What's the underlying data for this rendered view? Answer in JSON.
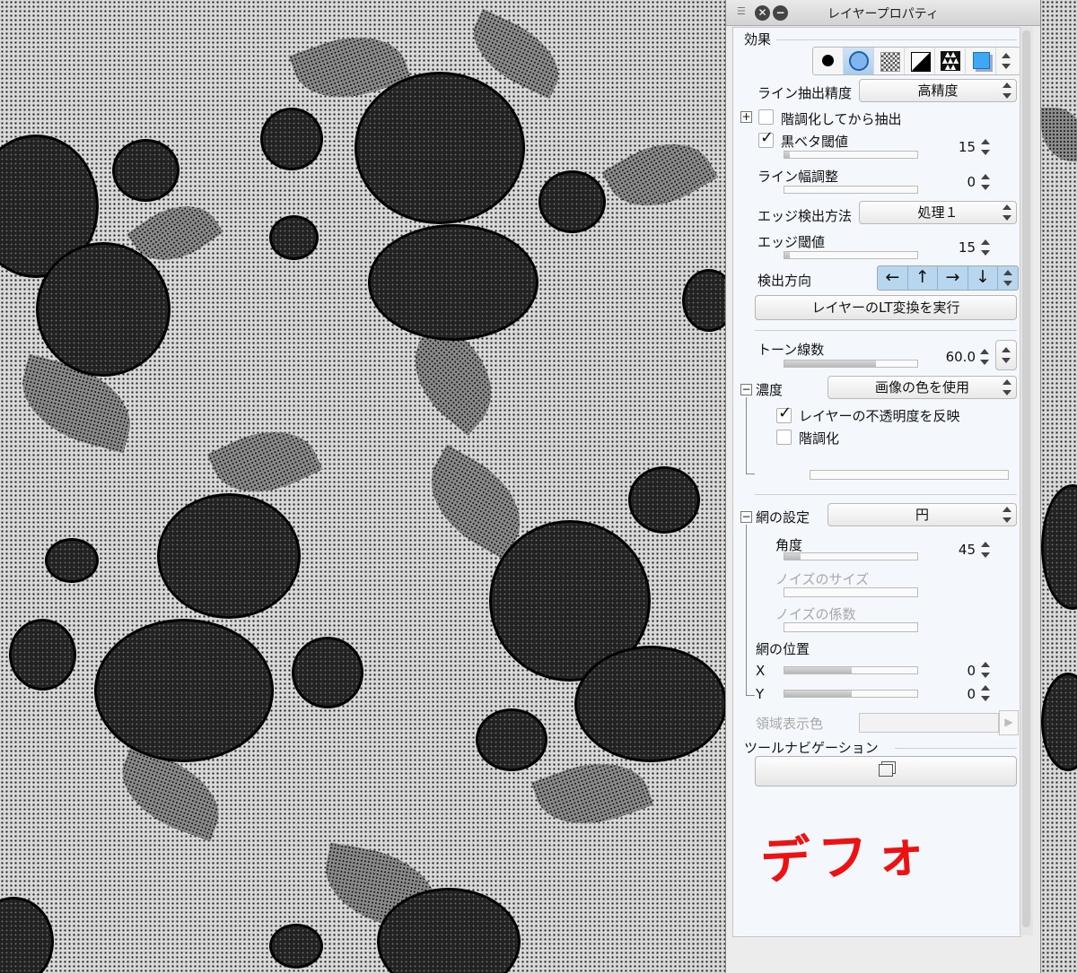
{
  "window": {
    "title": "レイヤープロパティ"
  },
  "effect": {
    "section_label": "効果",
    "icons": [
      "black-dot-icon",
      "circle-tone-icon",
      "checker-tone-icon",
      "diagonal-icon",
      "triangle-pattern-icon",
      "color-square-icon"
    ]
  },
  "line_extraction": {
    "precision_label": "ライン抽出精度",
    "precision_value": "高精度",
    "gradation_extract_label": "階調化してから抽出",
    "black_threshold_label": "黒ベタ閾値",
    "black_threshold_checked": true,
    "black_threshold_value": "15",
    "line_width_label": "ライン幅調整",
    "line_width_value": "0",
    "edge_method_label": "エッジ検出方法",
    "edge_method_value": "処理１",
    "edge_threshold_label": "エッジ閾値",
    "edge_threshold_value": "15",
    "direction_label": "検出方向",
    "direction_arrows": [
      "←",
      "↑",
      "→",
      "↓"
    ],
    "convert_button": "レイヤーのLT変換を実行"
  },
  "tone": {
    "frequency_label": "トーン線数",
    "frequency_value": "60.0",
    "density_label": "濃度",
    "density_value": "画像の色を使用",
    "reflect_opacity_label": "レイヤーの不透明度を反映",
    "reflect_opacity_checked": true,
    "gradation_label": "階調化",
    "gradation_checked": false,
    "screen_label": "網の設定",
    "screen_value": "円",
    "angle_label": "角度",
    "angle_value": "45",
    "noise_size_label": "ノイズのサイズ",
    "noise_factor_label": "ノイズの係数",
    "position_label": "網の位置",
    "x_label": "X",
    "x_value": "0",
    "y_label": "Y",
    "y_value": "0",
    "area_color_label": "領域表示色"
  },
  "tool_nav": {
    "section_label": "ツールナビゲーション"
  },
  "annotation": {
    "text": "デフォ",
    "color": "#ee1111"
  }
}
